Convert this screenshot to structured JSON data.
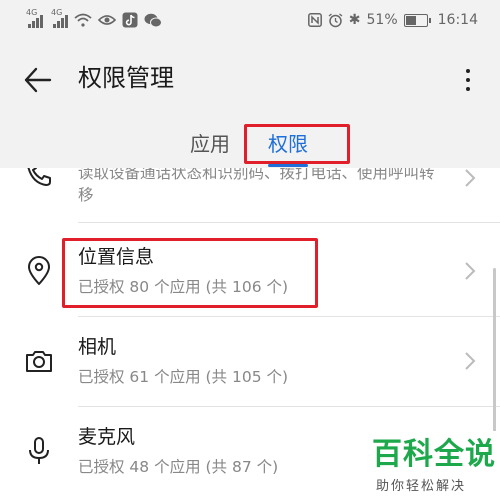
{
  "status_bar": {
    "signal1_label": "4G",
    "signal2_label": "4G",
    "battery": "51%",
    "time": "16:14"
  },
  "header": {
    "title": "权限管理"
  },
  "tabs": [
    {
      "label": "应用",
      "active": false
    },
    {
      "label": "权限",
      "active": true
    }
  ],
  "permissions": [
    {
      "icon": "phone-icon",
      "title": "",
      "subtitle": "读取设备通话状态和识别码、拨打电话、使用呼叫转移"
    },
    {
      "icon": "location-pin-icon",
      "title": "位置信息",
      "subtitle": "已授权 80 个应用 (共 106 个)"
    },
    {
      "icon": "camera-icon",
      "title": "相机",
      "subtitle": "已授权 61 个应用 (共 105 个)"
    },
    {
      "icon": "microphone-icon",
      "title": "麦克风",
      "subtitle": "已授权 48 个应用 (共 87 个)"
    }
  ],
  "watermark": {
    "title": "百科全说",
    "subtitle": "助你轻松解决"
  },
  "colors": {
    "accent": "#1e6fd9",
    "highlight": "#e01f2b",
    "watermark": "#1da84c"
  }
}
